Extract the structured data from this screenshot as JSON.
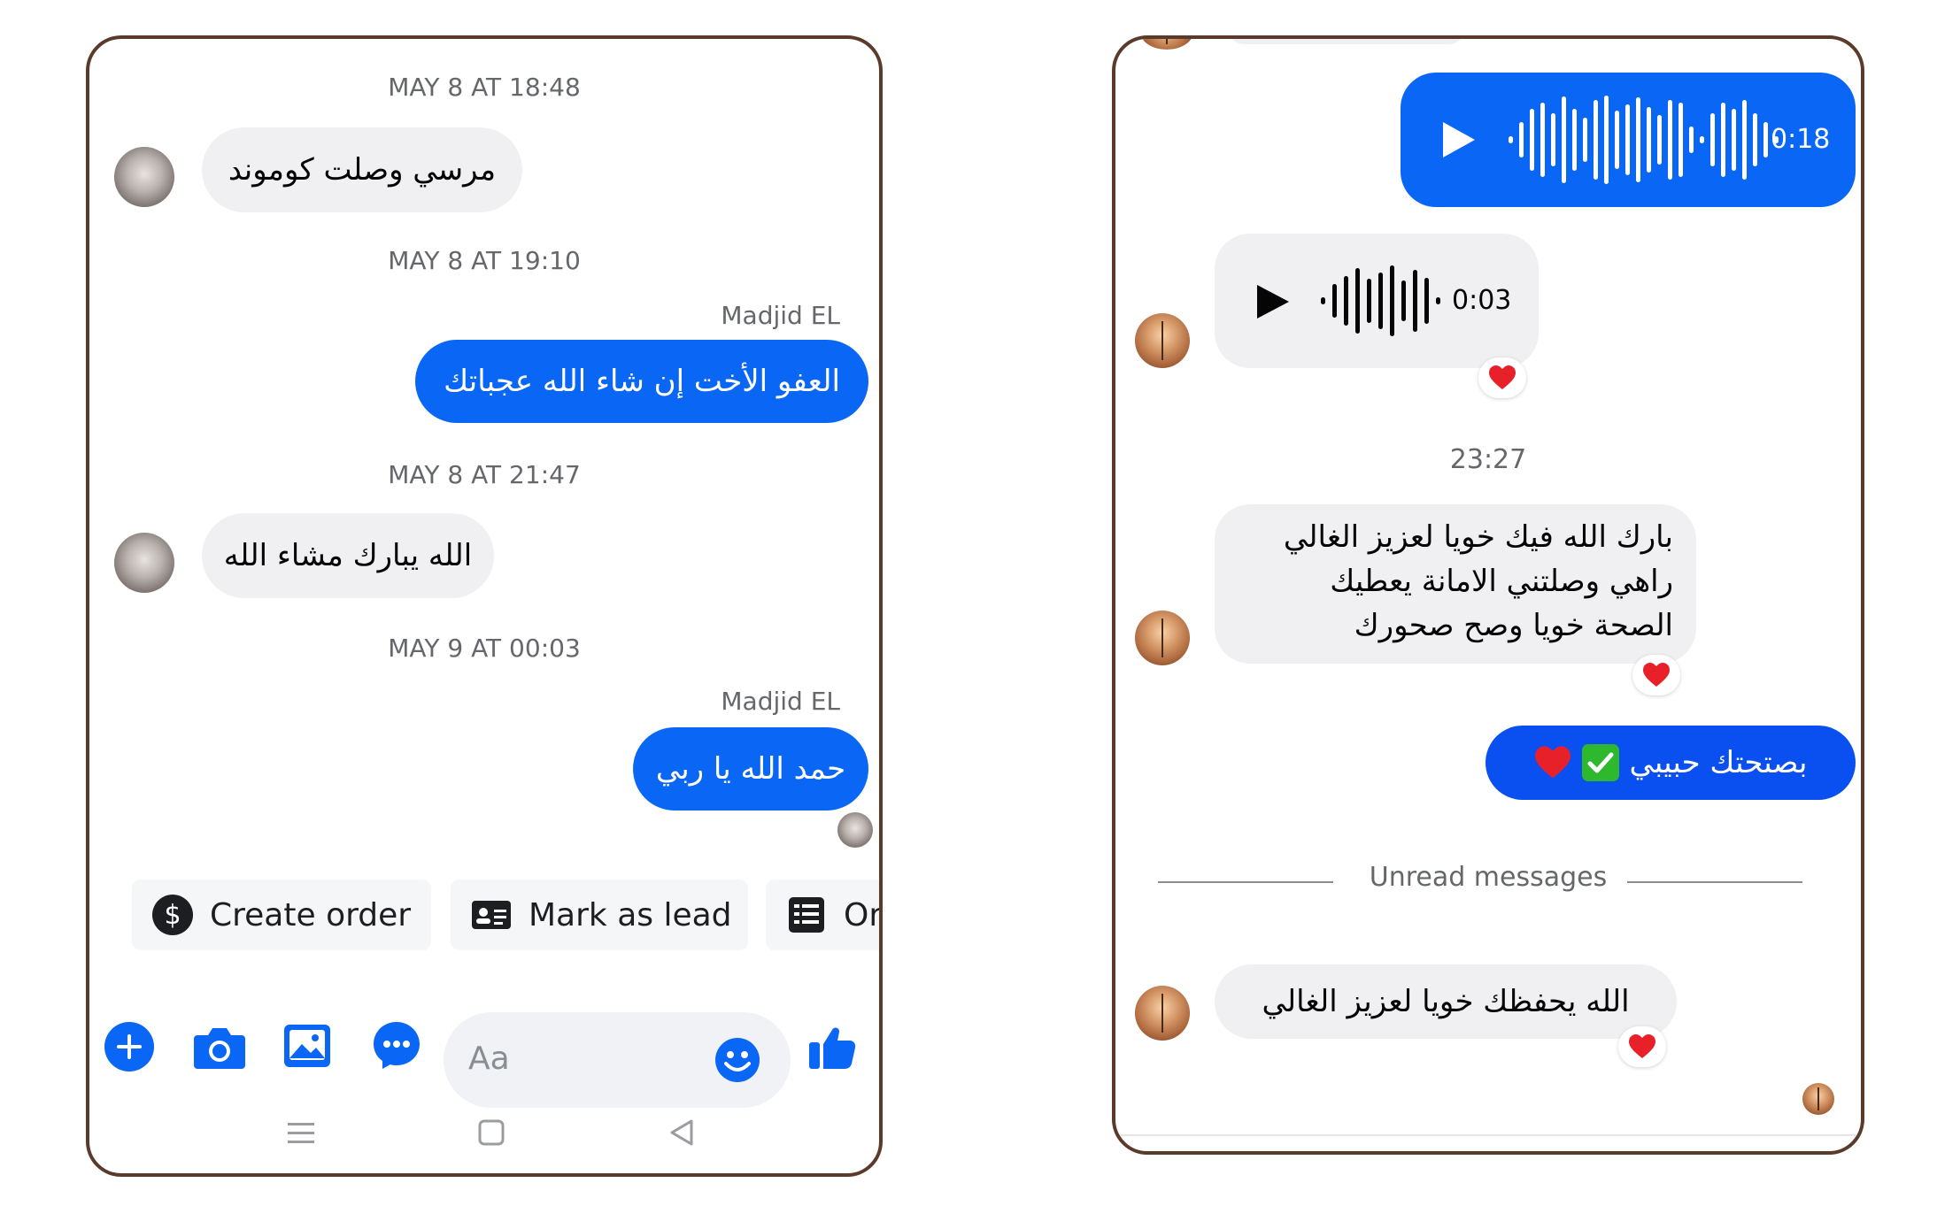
{
  "left": {
    "timestamps": [
      "MAY 8 AT 18:48",
      "MAY 8 AT 19:10",
      "MAY 8 AT 21:47",
      "MAY 9 AT 00:03"
    ],
    "messages": [
      {
        "text": "مرسي وصلت كوموند"
      },
      {
        "sender": "Madjid EL",
        "text": "العفو الأخت إن شاء الله عجباتك"
      },
      {
        "text": "الله يبارك مشاء الله"
      },
      {
        "sender": "Madjid EL",
        "text": "حمد الله يا ربي"
      }
    ],
    "actions": [
      {
        "label": "Create order",
        "icon": "dollar-icon"
      },
      {
        "label": "Mark as lead",
        "icon": "id-card-icon"
      },
      {
        "label": "Or",
        "icon": "list-icon"
      }
    ],
    "composer": {
      "placeholder": "Aa"
    },
    "colors": {
      "accent": "#0a66f5",
      "incoming": "#f0f0f2"
    }
  },
  "right": {
    "voice_out": {
      "duration": "0:18"
    },
    "voice_in": {
      "duration": "0:03",
      "reaction": "❤️"
    },
    "time": "23:27",
    "msg1": {
      "lines": [
        "بارك الله فيك خويا لعزيز الغالي",
        "راهي وصلتني الامانة يعطيك",
        "الصحة خويا وصح صحورك"
      ],
      "reaction": "❤️"
    },
    "reply": {
      "text": "بصتحتك حبيبي"
    },
    "unread": "Unread messages",
    "msg2": {
      "text": "الله يحفظك خويا لعزيز الغالي",
      "reaction": "❤️"
    }
  }
}
